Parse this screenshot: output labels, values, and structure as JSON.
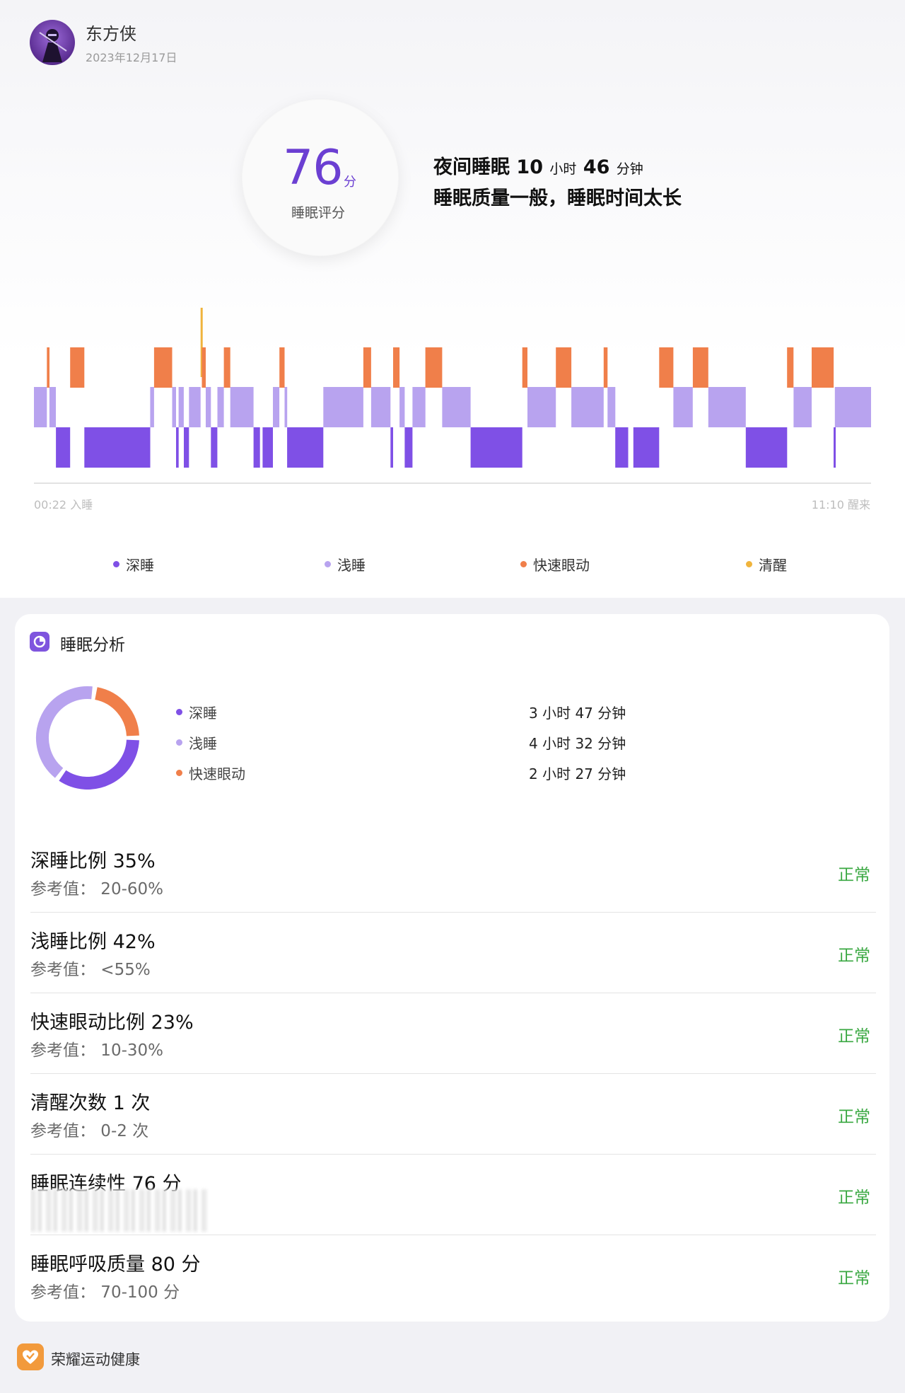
{
  "profile": {
    "name": "东方侠",
    "date": "2023年12月17日"
  },
  "score": {
    "value": "76",
    "unit": "分",
    "label": "睡眠评分"
  },
  "summary": {
    "prefix": "夜间睡眠",
    "hours": "10",
    "hours_unit": "小时",
    "minutes": "46",
    "minutes_unit": "分钟",
    "quality": "睡眠质量一般，睡眠时间太长"
  },
  "colors": {
    "deep": "#7f50e6",
    "light": "#b8a3ef",
    "rem": "#f07f4a",
    "awake": "#f0b43c",
    "normal": "#3aa842"
  },
  "timeline": {
    "start_label": "00:22 入睡",
    "end_label": "11:10 醒来",
    "legend": [
      "深睡",
      "浅睡",
      "快速眼动",
      "清醒"
    ]
  },
  "chart_data": {
    "type": "bar",
    "title": "",
    "categories": [
      "深睡",
      "浅睡",
      "快速眼动",
      "清醒"
    ],
    "x_range": [
      "00:22",
      "11:10"
    ],
    "stage_segments": [
      {
        "stage": "light",
        "start_min": 0,
        "end_min": 10
      },
      {
        "stage": "rem",
        "start_min": 10,
        "end_min": 12
      },
      {
        "stage": "light",
        "start_min": 12,
        "end_min": 17
      },
      {
        "stage": "deep",
        "start_min": 17,
        "end_min": 28
      },
      {
        "stage": "rem",
        "start_min": 28,
        "end_min": 39
      },
      {
        "stage": "deep",
        "start_min": 39,
        "end_min": 90
      },
      {
        "stage": "light",
        "start_min": 90,
        "end_min": 93
      },
      {
        "stage": "rem",
        "start_min": 93,
        "end_min": 107
      },
      {
        "stage": "light",
        "start_min": 107,
        "end_min": 110
      },
      {
        "stage": "deep",
        "start_min": 110,
        "end_min": 112
      },
      {
        "stage": "light",
        "start_min": 112,
        "end_min": 116
      },
      {
        "stage": "deep",
        "start_min": 116,
        "end_min": 120
      },
      {
        "stage": "light",
        "start_min": 120,
        "end_min": 129
      },
      {
        "stage": "awake",
        "start_min": 129,
        "end_min": 130
      },
      {
        "stage": "rem",
        "start_min": 130,
        "end_min": 133
      },
      {
        "stage": "light",
        "start_min": 133,
        "end_min": 137
      },
      {
        "stage": "deep",
        "start_min": 137,
        "end_min": 142
      },
      {
        "stage": "light",
        "start_min": 142,
        "end_min": 147
      },
      {
        "stage": "rem",
        "start_min": 147,
        "end_min": 152
      },
      {
        "stage": "light",
        "start_min": 152,
        "end_min": 170
      },
      {
        "stage": "deep",
        "start_min": 170,
        "end_min": 175
      },
      {
        "stage": "deep",
        "start_min": 177,
        "end_min": 185
      },
      {
        "stage": "light",
        "start_min": 185,
        "end_min": 190
      },
      {
        "stage": "rem",
        "start_min": 190,
        "end_min": 194
      },
      {
        "stage": "light",
        "start_min": 194,
        "end_min": 196
      },
      {
        "stage": "deep",
        "start_min": 196,
        "end_min": 224
      },
      {
        "stage": "light",
        "start_min": 224,
        "end_min": 255
      },
      {
        "stage": "rem",
        "start_min": 255,
        "end_min": 261
      },
      {
        "stage": "light",
        "start_min": 261,
        "end_min": 276
      },
      {
        "stage": "deep",
        "start_min": 276,
        "end_min": 278
      },
      {
        "stage": "rem",
        "start_min": 278,
        "end_min": 283
      },
      {
        "stage": "light",
        "start_min": 283,
        "end_min": 287
      },
      {
        "stage": "deep",
        "start_min": 287,
        "end_min": 293
      },
      {
        "stage": "light",
        "start_min": 293,
        "end_min": 303
      },
      {
        "stage": "rem",
        "start_min": 303,
        "end_min": 316
      },
      {
        "stage": "light",
        "start_min": 316,
        "end_min": 338
      },
      {
        "stage": "deep",
        "start_min": 338,
        "end_min": 378
      },
      {
        "stage": "rem",
        "start_min": 378,
        "end_min": 382
      },
      {
        "stage": "light",
        "start_min": 382,
        "end_min": 404
      },
      {
        "stage": "rem",
        "start_min": 404,
        "end_min": 416
      },
      {
        "stage": "light",
        "start_min": 416,
        "end_min": 441
      },
      {
        "stage": "rem",
        "start_min": 441,
        "end_min": 444
      },
      {
        "stage": "light",
        "start_min": 444,
        "end_min": 450
      },
      {
        "stage": "deep",
        "start_min": 450,
        "end_min": 460
      },
      {
        "stage": "deep",
        "start_min": 464,
        "end_min": 484
      },
      {
        "stage": "rem",
        "start_min": 484,
        "end_min": 495
      },
      {
        "stage": "light",
        "start_min": 495,
        "end_min": 510
      },
      {
        "stage": "rem",
        "start_min": 510,
        "end_min": 522
      },
      {
        "stage": "light",
        "start_min": 522,
        "end_min": 551
      },
      {
        "stage": "deep",
        "start_min": 551,
        "end_min": 583
      },
      {
        "stage": "rem",
        "start_min": 583,
        "end_min": 588
      },
      {
        "stage": "light",
        "start_min": 588,
        "end_min": 602
      },
      {
        "stage": "rem",
        "start_min": 602,
        "end_min": 619
      },
      {
        "stage": "deep",
        "start_min": 619,
        "end_min": 620
      },
      {
        "stage": "light",
        "start_min": 620,
        "end_min": 648
      }
    ]
  },
  "analysis": {
    "title": "睡眠分析",
    "items": [
      {
        "label": "深睡",
        "value": "3 小时 47 分钟",
        "minutes": 227
      },
      {
        "label": "浅睡",
        "value": "4 小时 32 分钟",
        "minutes": 272
      },
      {
        "label": "快速眼动",
        "value": "2 小时 27 分钟",
        "minutes": 147
      }
    ]
  },
  "metrics": [
    {
      "title": "深睡比例 35%",
      "ref": "参考值：  20-60%",
      "status": "正常"
    },
    {
      "title": "浅睡比例 42%",
      "ref": "参考值：  <55%",
      "status": "正常"
    },
    {
      "title": "快速眼动比例 23%",
      "ref": "参考值：  10-30%",
      "status": "正常"
    },
    {
      "title": "清醒次数 1 次",
      "ref": "参考值：  0-2 次",
      "status": "正常"
    },
    {
      "title": "睡眠连续性 76 分",
      "ref": "",
      "status": "正常"
    },
    {
      "title": "睡眠呼吸质量 80 分",
      "ref": "参考值：  70-100 分",
      "status": "正常"
    }
  ],
  "footer": {
    "app_name": "荣耀运动健康"
  }
}
